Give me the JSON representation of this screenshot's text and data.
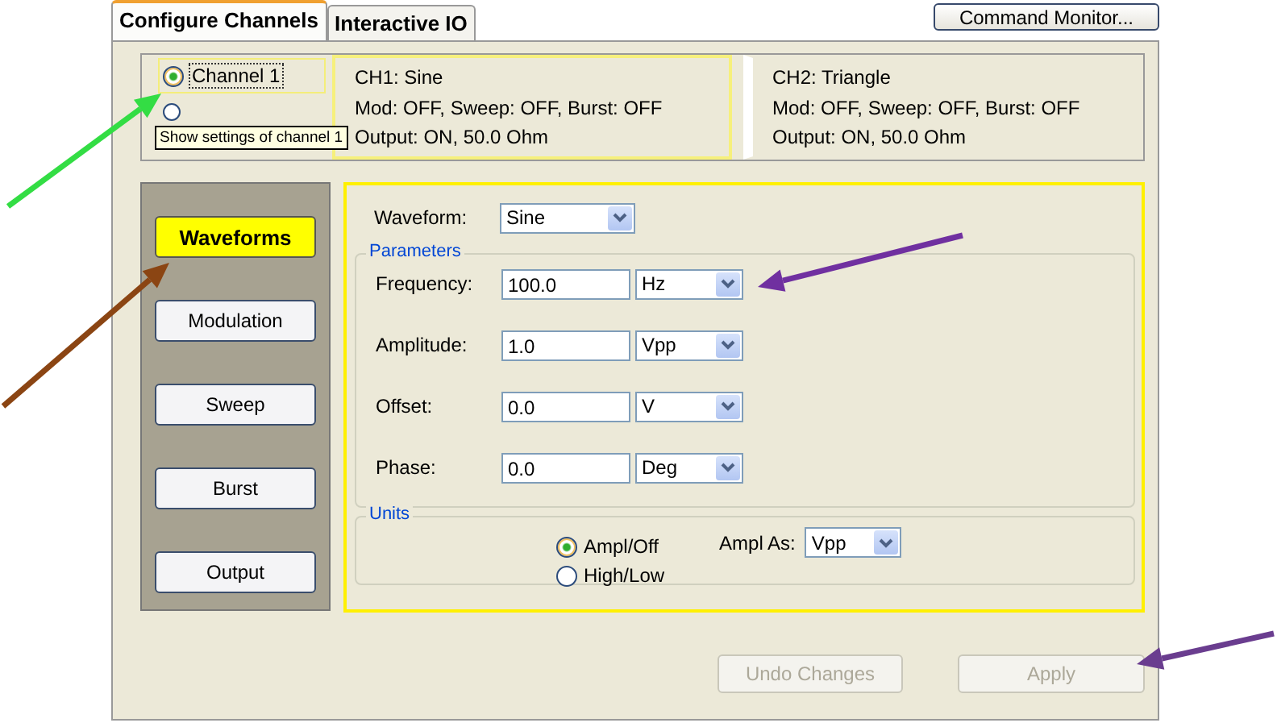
{
  "tabs": [
    {
      "label": "Configure Channels",
      "selected": true
    },
    {
      "label": "Interactive IO",
      "selected": false
    }
  ],
  "command_button": "Command Monitor...",
  "channel_select": [
    {
      "label": "Channel 1",
      "selected": true
    },
    {
      "selected": false
    }
  ],
  "tooltip": "Show settings of channel 1",
  "channel_summaries": [
    {
      "lines": [
        "CH1:   Sine",
        "Mod: OFF, Sweep: OFF, Burst: OFF",
        "Output:   ON, 50.0 Ohm"
      ],
      "highlighted": true
    },
    {
      "lines": [
        "CH2:   Triangle",
        "Mod: OFF, Sweep: OFF, Burst: OFF",
        "Output:   ON, 50.0 Ohm"
      ],
      "highlighted": false
    }
  ],
  "nav": [
    {
      "label": "Waveforms",
      "selected": true
    },
    {
      "label": "Modulation",
      "selected": false
    },
    {
      "label": "Sweep",
      "selected": false
    },
    {
      "label": "Burst",
      "selected": false
    },
    {
      "label": "Output",
      "selected": false
    }
  ],
  "waveform": {
    "label": "Waveform:",
    "value": "Sine"
  },
  "parameters": {
    "title": "Parameters",
    "rows": [
      {
        "label": "Frequency:",
        "value": "100.0",
        "unit": "Hz"
      },
      {
        "label": "Amplitude:",
        "value": "1.0",
        "unit": "Vpp"
      },
      {
        "label": "Offset:",
        "value": "0.0",
        "unit": "V"
      },
      {
        "label": "Phase:",
        "value": "0.0",
        "unit": "Deg"
      }
    ]
  },
  "units": {
    "title": "Units",
    "options": [
      {
        "label": "Ampl/Off",
        "selected": true
      },
      {
        "label": "High/Low",
        "selected": false
      }
    ],
    "ampl_as": {
      "label": "Ampl As:",
      "value": "Vpp"
    }
  },
  "buttons": [
    {
      "label": "Undo Changes",
      "disabled": true
    },
    {
      "label": "Apply",
      "disabled": true
    }
  ],
  "annotations": [
    {
      "color": "#33dd44"
    },
    {
      "color": "#8b4513"
    },
    {
      "color": "#7030a0"
    },
    {
      "color": "#6a3d8f"
    }
  ]
}
